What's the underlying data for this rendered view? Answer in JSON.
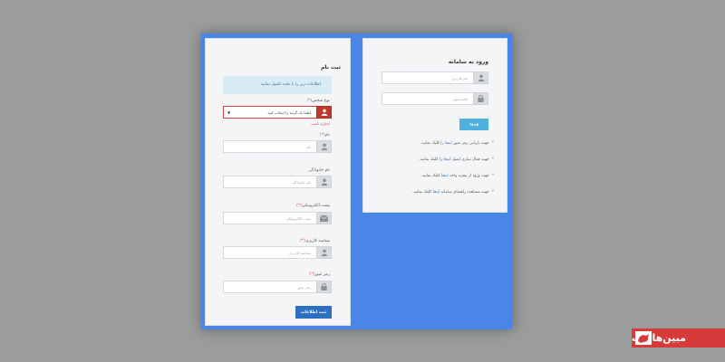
{
  "register": {
    "title": "ثبت نام",
    "alert": "اطلاعات زیر را با دقت تکمیل نمایید",
    "person_type_label": "نوع شخص",
    "person_type_value": "لطفا یک گزینه را انتخاب کنید",
    "person_type_error": "اجباری است",
    "name_label": "نام",
    "name_placeholder": "نام",
    "lastname_label": "نام خانوادگی",
    "lastname_placeholder": "نام خانوادگی",
    "email_label": "پست الکترونیکی",
    "email_placeholder": "پست الکترونیکی",
    "username_label": "شناسه کاربری",
    "username_placeholder": "شناسه کاربری",
    "password_label": "رمز عبور",
    "password_placeholder": "رمز عبور",
    "required_mark": "(*)",
    "submit_label": "ثبت اطلاعات"
  },
  "login": {
    "title": "ورود به سامانه",
    "username_placeholder": "نام کاربری",
    "password_placeholder": "کلمه عبور",
    "submit_label": "ورود",
    "notes": [
      {
        "before": "جهت بازیابی رمز عبور",
        "link": "اینجا",
        "after": "را کلیک نمایید."
      },
      {
        "before": "جهت فعال سازی ایمیل",
        "link": "اینجا",
        "after": "را کلیک نمایید."
      },
      {
        "before": "جهت ورود از پنجره واحد",
        "link": "اینجا",
        "after": "کلیک نمایید."
      },
      {
        "before": "جهت مشاهده راهنمای سامانه",
        "link": "اینجا",
        "after": "کلیک نمایید."
      }
    ],
    "star": "*"
  },
  "logo": {
    "text": "مبین‌هاست"
  },
  "colors": {
    "frame": "#4a86e8",
    "error": "#d64541",
    "primary": "#2f6fbf",
    "login_button": "#4fb0dc",
    "logo_bg": "#d63a3a"
  },
  "icons": {
    "user": "user-icon",
    "envelope": "envelope-icon",
    "lock": "lock-icon",
    "caret": "caret-down-icon"
  }
}
